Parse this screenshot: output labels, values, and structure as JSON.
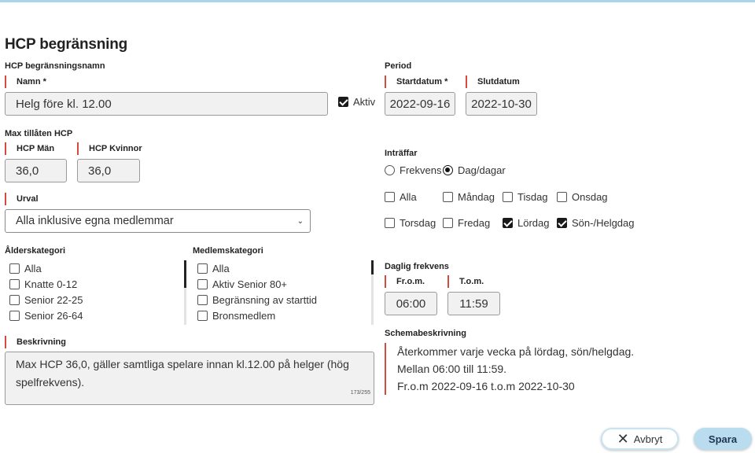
{
  "page": {
    "title": "HCP begränsning"
  },
  "restriction": {
    "section_label": "HCP begränsningsnamn",
    "name_label": "Namn *",
    "name_value": "Helg före kl. 12.00",
    "active_label": "Aktiv",
    "active_checked": true
  },
  "max_hcp": {
    "section_label": "Max tillåten HCP",
    "men_label": "HCP Män",
    "men_value": "36,0",
    "women_label": "HCP Kvinnor",
    "women_value": "36,0"
  },
  "selection": {
    "label": "Urval",
    "value": "Alla inklusive egna medlemmar"
  },
  "age_category": {
    "label": "Ålderskategori",
    "items": [
      {
        "label": "Alla",
        "checked": false
      },
      {
        "label": "Knatte 0-12",
        "checked": false
      },
      {
        "label": "Senior 22-25",
        "checked": false
      },
      {
        "label": "Senior 26-64",
        "checked": false
      }
    ]
  },
  "member_category": {
    "label": "Medlemskategori",
    "items": [
      {
        "label": "Alla",
        "checked": false
      },
      {
        "label": "Aktiv Senior 80+",
        "checked": false
      },
      {
        "label": "Begränsning av starttid",
        "checked": false
      },
      {
        "label": "Bronsmedlem",
        "checked": false
      }
    ]
  },
  "description": {
    "label": "Beskrivning",
    "value": "Max HCP 36,0, gäller samtliga spelare innan kl.12.00 på helger (hög spelfrekvens).",
    "counter": "173/255"
  },
  "period": {
    "section_label": "Period",
    "start_label": "Startdatum *",
    "start_value": "2022-09-16",
    "end_label": "Slutdatum",
    "end_value": "2022-10-30"
  },
  "occurs": {
    "section_label": "Inträffar",
    "mode_frequency": "Frekvens",
    "mode_days": "Dag/dagar",
    "selected_mode": "Dag/dagar",
    "days": [
      {
        "label": "Alla",
        "checked": false
      },
      {
        "label": "Måndag",
        "checked": false
      },
      {
        "label": "Tisdag",
        "checked": false
      },
      {
        "label": "Onsdag",
        "checked": false
      },
      {
        "label": "Torsdag",
        "checked": false
      },
      {
        "label": "Fredag",
        "checked": false
      },
      {
        "label": "Lördag",
        "checked": true
      },
      {
        "label": "Sön-/Helgdag",
        "checked": true
      }
    ]
  },
  "daily_frequency": {
    "section_label": "Daglig frekvens",
    "from_label": "Fr.o.m.",
    "from_value": "06:00",
    "to_label": "T.o.m.",
    "to_value": "11:59"
  },
  "schedule": {
    "section_label": "Schemabeskrivning",
    "lines": [
      "Återkommer varje vecka på lördag, sön/helgdag.",
      "Mellan 06:00 till 11:59.",
      "Fr.o.m 2022-09-16 t.o.m 2022-10-30"
    ]
  },
  "actions": {
    "cancel_label": "Avbryt",
    "save_label": "Spara"
  },
  "colors": {
    "accent_bar": "#d24b3e",
    "save_button": "#b9dcee",
    "top_line": "#a9d6ec"
  }
}
